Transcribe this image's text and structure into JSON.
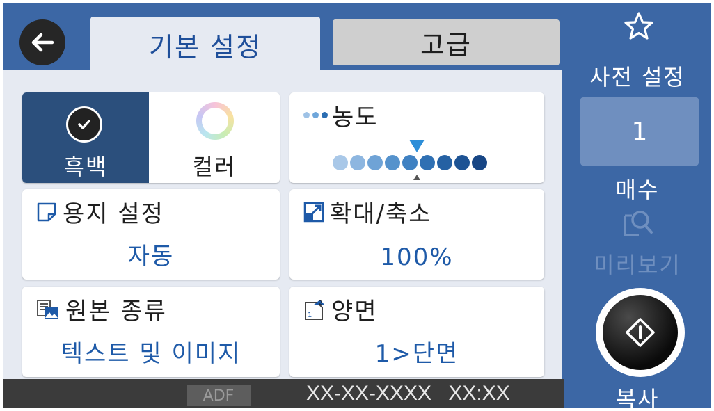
{
  "header": {
    "tabs": [
      {
        "label": "기본 설정",
        "active": true
      },
      {
        "label": "고급",
        "active": false
      }
    ]
  },
  "settings": {
    "color_mode": {
      "options": [
        {
          "label": "흑백",
          "selected": true
        },
        {
          "label": "컬러",
          "selected": false
        }
      ]
    },
    "density": {
      "title": "농도",
      "level": 6,
      "levels": 9,
      "accent": "#2d8ed8"
    },
    "paper": {
      "title": "용지 설정",
      "value": "자동"
    },
    "zoom": {
      "title": "확대/축소",
      "value": "100%"
    },
    "original_type": {
      "title": "원본 종류",
      "value": "텍스트 및 이미지"
    },
    "duplex": {
      "title": "양면",
      "value": "1>단면"
    }
  },
  "sidebar": {
    "presets_label": "사전 설정",
    "copies_value": "1",
    "copies_label": "매수",
    "preview_label": "미리보기",
    "start_label": "복사"
  },
  "status": {
    "source": "ADF",
    "datetime": "XX-XX-XXXX  XX:XX"
  },
  "colors": {
    "brand_blue": "#3c67a5",
    "selected_tile": "#2b4f7c",
    "value_text": "#1e5aa8",
    "status_bar": "#3b3b3b"
  }
}
